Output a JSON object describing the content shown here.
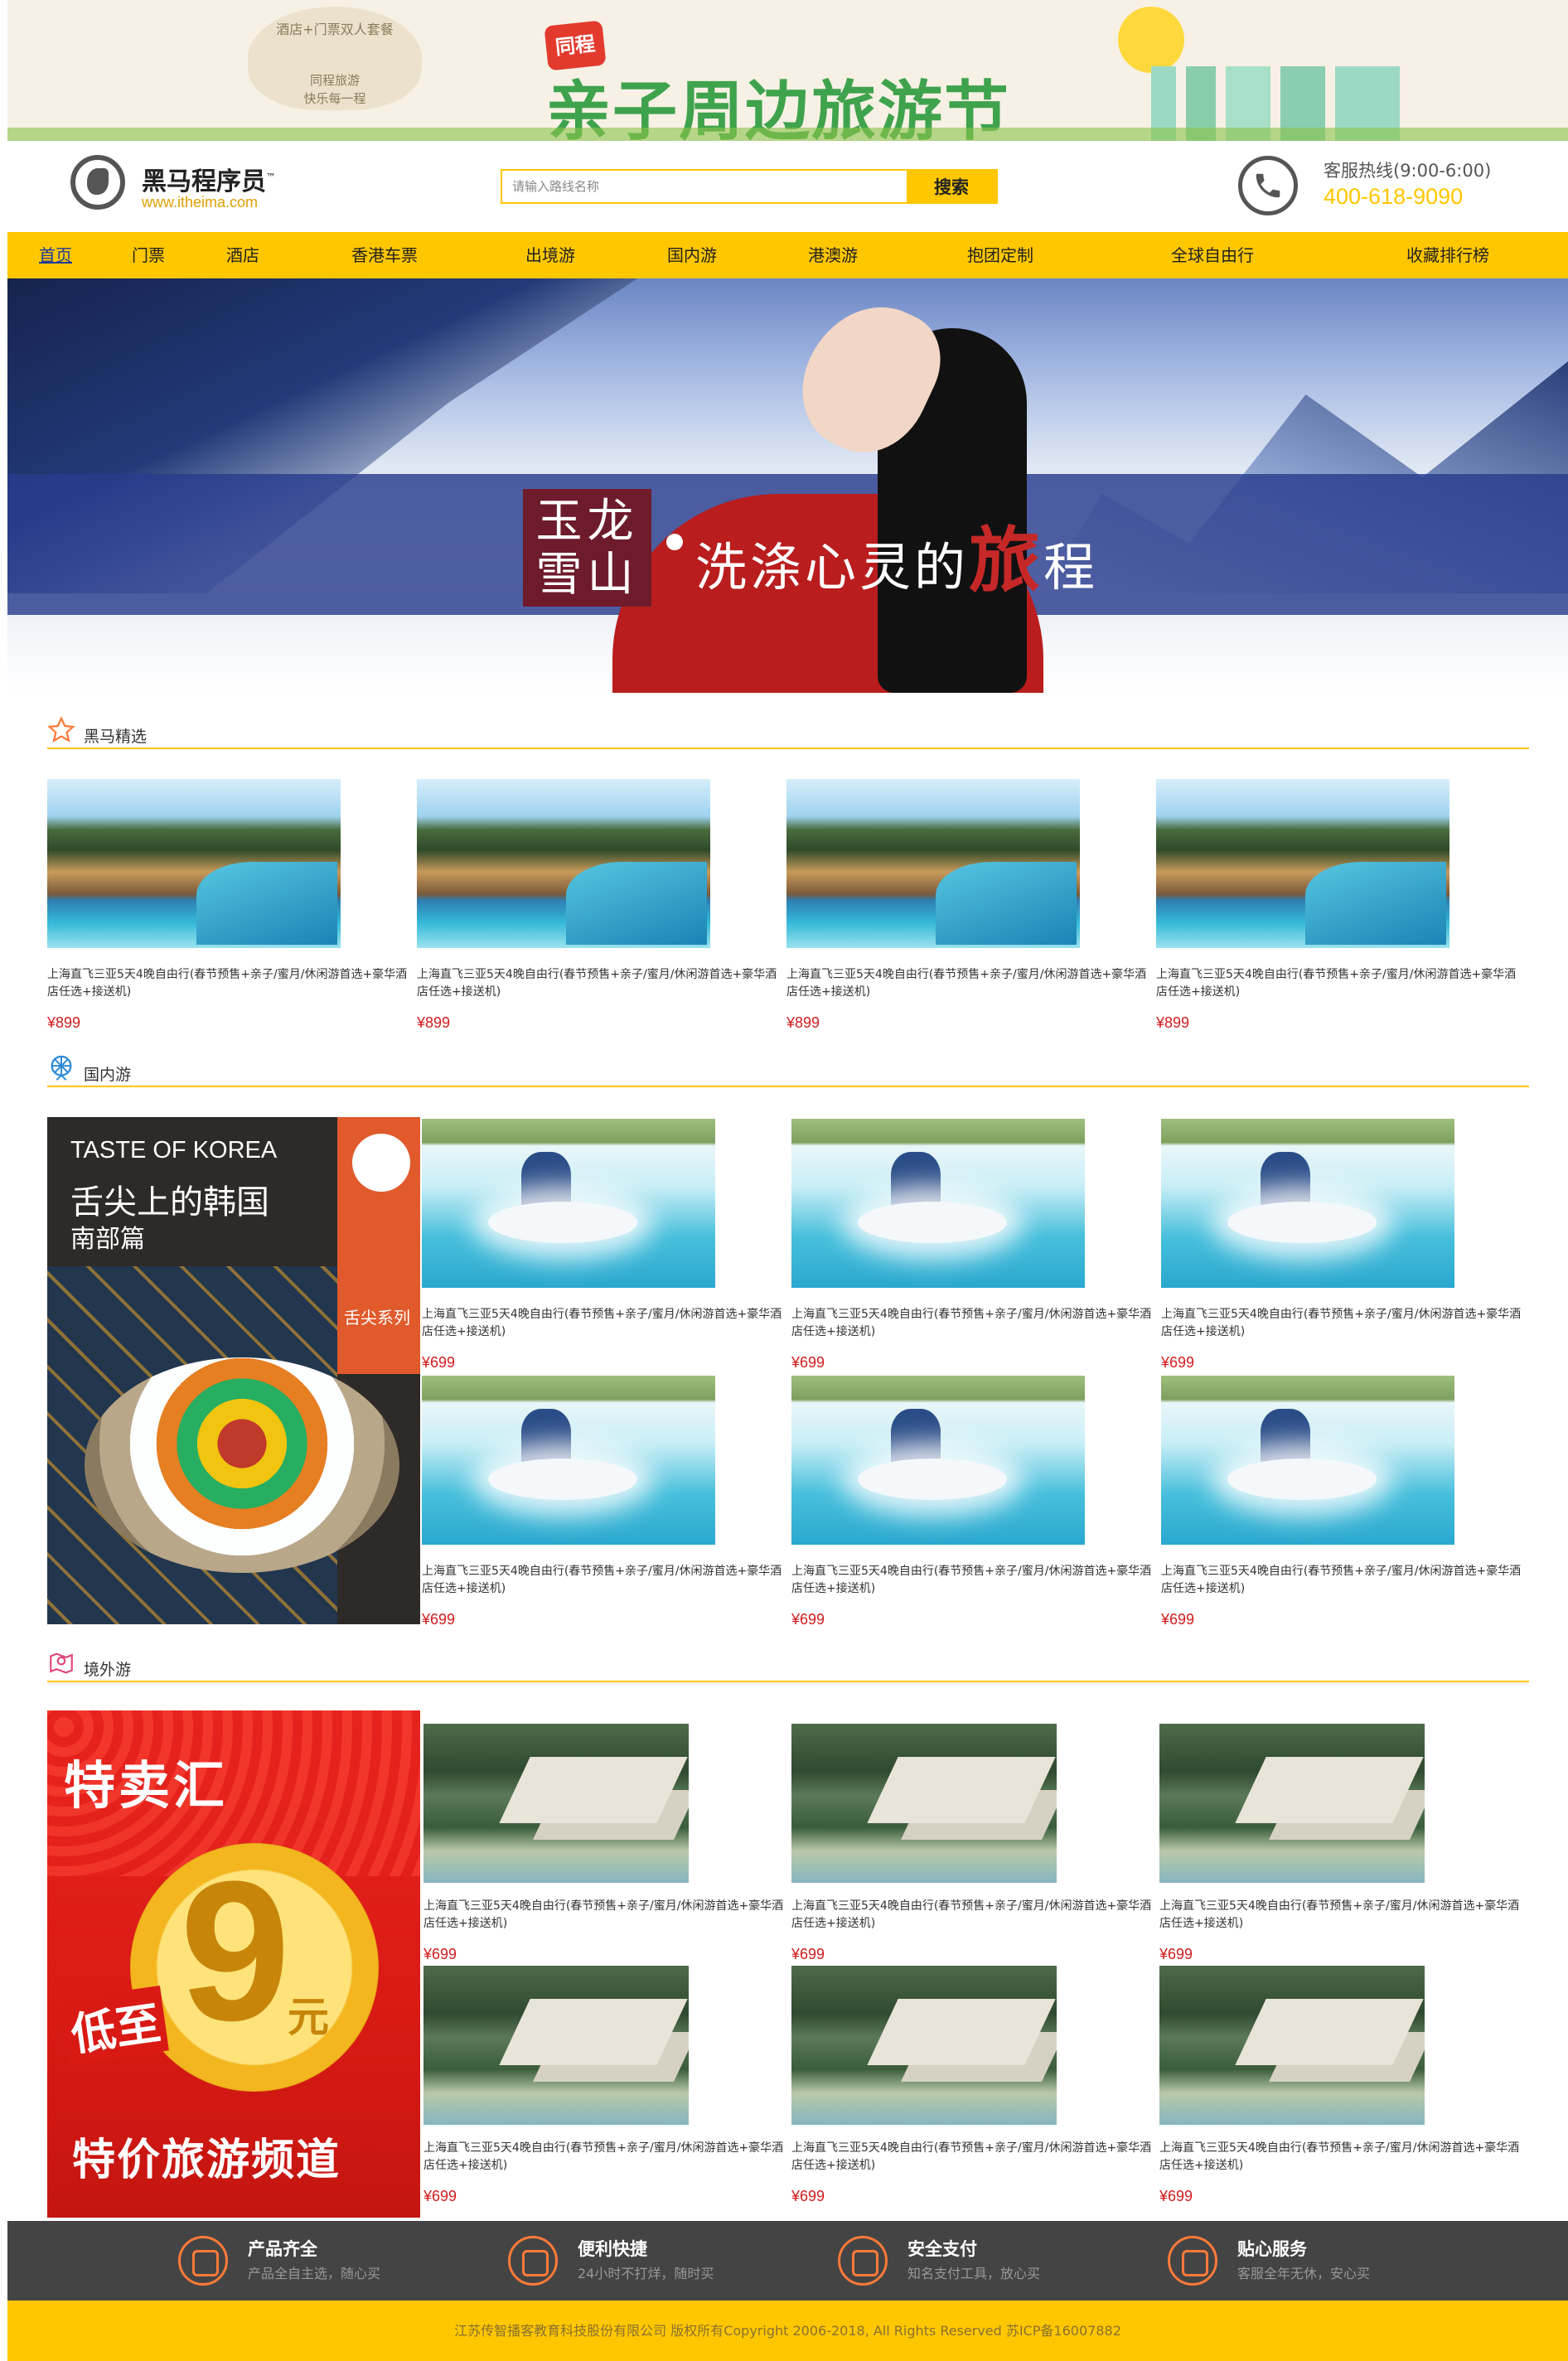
{
  "top_banner": {
    "left_line1": "酒店+门票双人套餐",
    "left_line2": "同程旅游",
    "left_line3": "快乐每一程",
    "badge": "同程",
    "title": "亲子周边旅游节"
  },
  "header": {
    "logo_name": "黑马程序员",
    "logo_tm": "™",
    "logo_url": "www.itheima.com",
    "search_placeholder": "请输入路线名称",
    "search_button": "搜索",
    "hotline_label": "客服热线(9:00-6:00)",
    "hotline_number": "400-618-9090"
  },
  "nav": [
    {
      "label": "首页",
      "active": true
    },
    {
      "label": "门票"
    },
    {
      "label": "酒店"
    },
    {
      "label": "香港车票"
    },
    {
      "label": "出境游"
    },
    {
      "label": "国内游"
    },
    {
      "label": "港澳游"
    },
    {
      "label": "抱团定制"
    },
    {
      "label": "全球自由行"
    },
    {
      "label": "收藏排行榜"
    }
  ],
  "hero": {
    "seal_text": "玉龙雪山",
    "slogan_a": "洗涤心灵的",
    "slogan_b": "旅",
    "slogan_c": "程"
  },
  "sections": {
    "featured": {
      "title": "黑马精选",
      "items": [
        {
          "title": "上海直飞三亚5天4晚自由行(春节预售+亲子/蜜月/休闲游首选+豪华酒店任选+接送机)",
          "price": "¥899"
        },
        {
          "title": "上海直飞三亚5天4晚自由行(春节预售+亲子/蜜月/休闲游首选+豪华酒店任选+接送机)",
          "price": "¥899"
        },
        {
          "title": "上海直飞三亚5天4晚自由行(春节预售+亲子/蜜月/休闲游首选+豪华酒店任选+接送机)",
          "price": "¥899"
        },
        {
          "title": "上海直飞三亚5天4晚自由行(春节预售+亲子/蜜月/休闲游首选+豪华酒店任选+接送机)",
          "price": "¥899"
        }
      ]
    },
    "domestic": {
      "title": "国内游",
      "ad": {
        "en": "TASTE OF KOREA",
        "cn1": "舌尖上的韩国",
        "cn2": "南部篇",
        "series": "舌尖系列"
      },
      "items": [
        {
          "title": "上海直飞三亚5天4晚自由行(春节预售+亲子/蜜月/休闲游首选+豪华酒店任选+接送机)",
          "price": "¥699"
        },
        {
          "title": "上海直飞三亚5天4晚自由行(春节预售+亲子/蜜月/休闲游首选+豪华酒店任选+接送机)",
          "price": "¥699"
        },
        {
          "title": "上海直飞三亚5天4晚自由行(春节预售+亲子/蜜月/休闲游首选+豪华酒店任选+接送机)",
          "price": "¥699"
        },
        {
          "title": "上海直飞三亚5天4晚自由行(春节预售+亲子/蜜月/休闲游首选+豪华酒店任选+接送机)",
          "price": "¥699"
        },
        {
          "title": "上海直飞三亚5天4晚自由行(春节预售+亲子/蜜月/休闲游首选+豪华酒店任选+接送机)",
          "price": "¥699"
        },
        {
          "title": "上海直飞三亚5天4晚自由行(春节预售+亲子/蜜月/休闲游首选+豪华酒店任选+接送机)",
          "price": "¥699"
        }
      ]
    },
    "overseas": {
      "title": "境外游",
      "ad": {
        "brand": "特卖汇",
        "low": "低至",
        "nine": "9",
        "yuan": "元",
        "sub": "特价旅游频道"
      },
      "items": [
        {
          "title": "上海直飞三亚5天4晚自由行(春节预售+亲子/蜜月/休闲游首选+豪华酒店任选+接送机)",
          "price": "¥699"
        },
        {
          "title": "上海直飞三亚5天4晚自由行(春节预售+亲子/蜜月/休闲游首选+豪华酒店任选+接送机)",
          "price": "¥699"
        },
        {
          "title": "上海直飞三亚5天4晚自由行(春节预售+亲子/蜜月/休闲游首选+豪华酒店任选+接送机)",
          "price": "¥699"
        },
        {
          "title": "上海直飞三亚5天4晚自由行(春节预售+亲子/蜜月/休闲游首选+豪华酒店任选+接送机)",
          "price": "¥699"
        },
        {
          "title": "上海直飞三亚5天4晚自由行(春节预售+亲子/蜜月/休闲游首选+豪华酒店任选+接送机)",
          "price": "¥699"
        },
        {
          "title": "上海直飞三亚5天4晚自由行(春节预售+亲子/蜜月/休闲游首选+豪华酒店任选+接送机)",
          "price": "¥699"
        }
      ]
    }
  },
  "features": [
    {
      "title": "产品齐全",
      "desc": "产品全自主选，随心买"
    },
    {
      "title": "便利快捷",
      "desc": "24小时不打烊，随时买"
    },
    {
      "title": "安全支付",
      "desc": "知名支付工具，放心买"
    },
    {
      "title": "贴心服务",
      "desc": "客服全年无休，安心买"
    }
  ],
  "copyright": "江苏传智播客教育科技股份有限公司 版权所有Copyright 2006-2018, All Rights Reserved 苏ICP备16007882",
  "colors": {
    "accent": "#ffc700",
    "price": "#d01c1c",
    "footer_bg": "#444444"
  }
}
